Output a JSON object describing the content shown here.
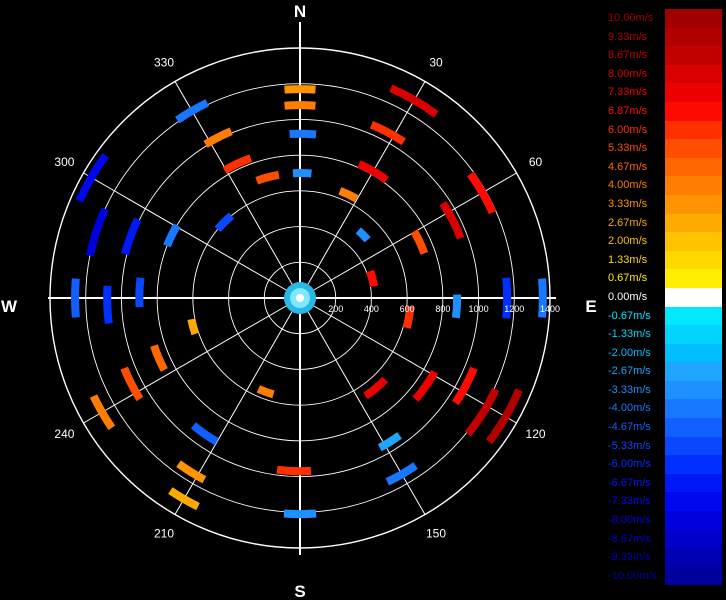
{
  "chart_data": {
    "type": "polar-radar",
    "compass": [
      "N",
      "E",
      "S",
      "W"
    ],
    "angle_labels": [
      "30",
      "60",
      "120",
      "150",
      "210",
      "240",
      "300",
      "330"
    ],
    "range_ticks": [
      "200",
      "400",
      "600",
      "800",
      "1000",
      "1200",
      "1400"
    ],
    "range_max": 1400,
    "grid": true,
    "legend": {
      "placement": "right",
      "entries": [
        {
          "label": "10.00m/s",
          "color": "#a00000"
        },
        {
          "label": "9.33m/s",
          "color": "#b00000"
        },
        {
          "label": "8.67m/s",
          "color": "#c20000"
        },
        {
          "label": "8.00m/s",
          "color": "#d80000"
        },
        {
          "label": "7.33m/s",
          "color": "#ec0000"
        },
        {
          "label": "6.87m/s",
          "color": "#ff0a00"
        },
        {
          "label": "6.00m/s",
          "color": "#ff3000"
        },
        {
          "label": "5.33m/s",
          "color": "#ff4e00"
        },
        {
          "label": "4.67m/s",
          "color": "#ff6800"
        },
        {
          "label": "4.00m/s",
          "color": "#ff7d00"
        },
        {
          "label": "3.33m/s",
          "color": "#ff9300"
        },
        {
          "label": "2.67m/s",
          "color": "#ffaa00"
        },
        {
          "label": "2.00m/s",
          "color": "#ffc200"
        },
        {
          "label": "1.33m/s",
          "color": "#ffd800"
        },
        {
          "label": "0.67m/s",
          "color": "#ffee00"
        },
        {
          "label": "0.00m/s",
          "color": "#ffffff"
        },
        {
          "label": "-0.67m/s",
          "color": "#00e8ff"
        },
        {
          "label": "-1.33m/s",
          "color": "#00d4ff"
        },
        {
          "label": "-2.00m/s",
          "color": "#00beff"
        },
        {
          "label": "-2.67m/s",
          "color": "#1ea6ff"
        },
        {
          "label": "-3.33m/s",
          "color": "#1e90ff"
        },
        {
          "label": "-4.00m/s",
          "color": "#1878ff"
        },
        {
          "label": "-4.67m/s",
          "color": "#1060ff"
        },
        {
          "label": "-5.33m/s",
          "color": "#0a48ff"
        },
        {
          "label": "-6.00m/s",
          "color": "#0030ff"
        },
        {
          "label": "-6.67m/s",
          "color": "#0018f8"
        },
        {
          "label": "-7.33m/s",
          "color": "#0008ee"
        },
        {
          "label": "-8.00m/s",
          "color": "#0000dc"
        },
        {
          "label": "-8.67m/s",
          "color": "#0000c8"
        },
        {
          "label": "-9.33m/s",
          "color": "#0000b2"
        },
        {
          "label": "-10.00m/s",
          "color": "#00009c"
        }
      ]
    },
    "gates": [
      {
        "az": 0,
        "r": 1170,
        "v": 3.3
      },
      {
        "az": 0,
        "r": 1080,
        "v": 4.0
      },
      {
        "az": 1,
        "r": 920,
        "v": -4.0
      },
      {
        "az": 1,
        "r": 700,
        "v": -3.3
      },
      {
        "az": 30,
        "r": 1280,
        "v": 8.0
      },
      {
        "az": 28,
        "r": 1050,
        "v": 6.0
      },
      {
        "az": 30,
        "r": 820,
        "v": 7.3
      },
      {
        "az": 25,
        "r": 640,
        "v": 4.0
      },
      {
        "az": 60,
        "r": 1180,
        "v": 6.9
      },
      {
        "az": 63,
        "r": 960,
        "v": 8.0
      },
      {
        "az": 65,
        "r": 740,
        "v": 5.3
      },
      {
        "az": 90,
        "r": 1360,
        "v": -4.0
      },
      {
        "az": 90,
        "r": 1160,
        "v": -6.0
      },
      {
        "az": 93,
        "r": 880,
        "v": -3.3
      },
      {
        "az": 120,
        "r": 1330,
        "v": 9.3
      },
      {
        "az": 122,
        "r": 1210,
        "v": 8.7
      },
      {
        "az": 118,
        "r": 1050,
        "v": 6.9
      },
      {
        "az": 125,
        "r": 860,
        "v": 7.3
      },
      {
        "az": 150,
        "r": 1140,
        "v": -4.0
      },
      {
        "az": 148,
        "r": 950,
        "v": -2.7
      },
      {
        "az": 180,
        "r": 1210,
        "v": -3.3
      },
      {
        "az": 182,
        "r": 970,
        "v": 6.0
      },
      {
        "az": 210,
        "r": 1300,
        "v": 2.7
      },
      {
        "az": 212,
        "r": 1150,
        "v": 3.3
      },
      {
        "az": 215,
        "r": 930,
        "v": -4.7
      },
      {
        "az": 240,
        "r": 1280,
        "v": 4.0
      },
      {
        "az": 243,
        "r": 1060,
        "v": 5.3
      },
      {
        "az": 247,
        "r": 860,
        "v": 4.7
      },
      {
        "az": 270,
        "r": 1260,
        "v": -4.7
      },
      {
        "az": 268,
        "r": 1080,
        "v": -6.0
      },
      {
        "az": 272,
        "r": 900,
        "v": -5.3
      },
      {
        "az": 288,
        "r": 1200,
        "v": -8.0
      },
      {
        "az": 290,
        "r": 1010,
        "v": -6.7
      },
      {
        "az": 296,
        "r": 800,
        "v": -4.0
      },
      {
        "az": 300,
        "r": 1350,
        "v": -7.3
      },
      {
        "az": 330,
        "r": 1210,
        "v": -4.0
      },
      {
        "az": 333,
        "r": 1010,
        "v": 4.0
      },
      {
        "az": 335,
        "r": 830,
        "v": 6.0
      },
      {
        "az": 345,
        "r": 700,
        "v": 5.3
      },
      {
        "az": 100,
        "r": 620,
        "v": 6.0
      },
      {
        "az": 140,
        "r": 660,
        "v": 7.3
      },
      {
        "az": 200,
        "r": 560,
        "v": 4.0
      },
      {
        "az": 255,
        "r": 620,
        "v": 2.7
      },
      {
        "az": 315,
        "r": 600,
        "v": -5.3
      },
      {
        "az": 45,
        "r": 500,
        "v": -3.3
      },
      {
        "az": 75,
        "r": 420,
        "v": 6.9
      }
    ]
  }
}
